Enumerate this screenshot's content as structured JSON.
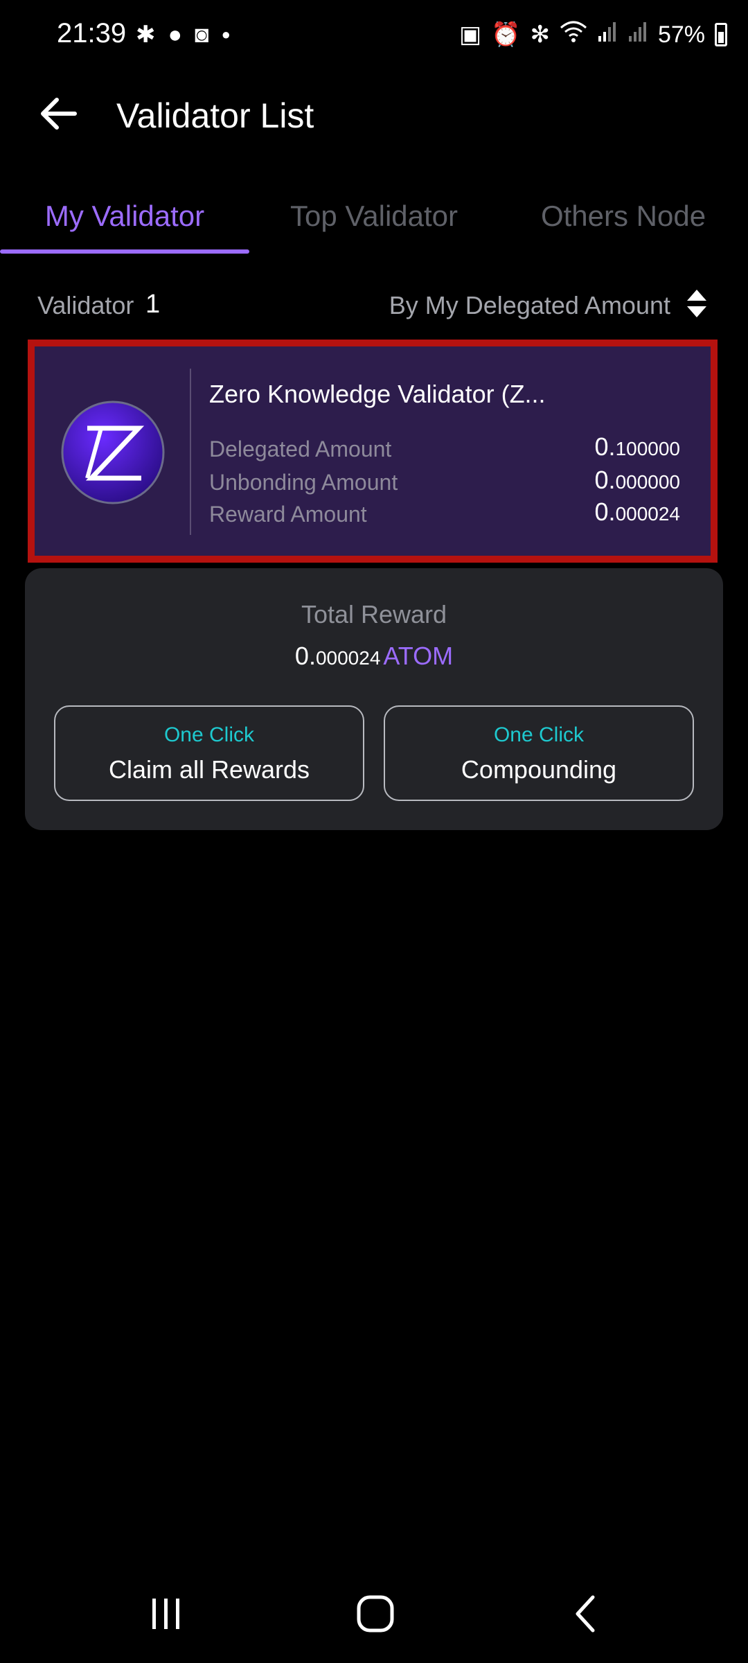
{
  "status_bar": {
    "time": "21:39",
    "battery": "57%",
    "left_icons": [
      "slack-icon",
      "chat-icon",
      "camera-app-icon",
      "dot-icon"
    ],
    "right_icons": [
      "battery-saver-icon",
      "alarm-icon",
      "bluetooth-icon",
      "wifi-icon",
      "signal-icon",
      "signal-icon-2"
    ]
  },
  "app_bar": {
    "title": "Validator List"
  },
  "tabs": [
    {
      "label": "My Validator",
      "active": true
    },
    {
      "label": "Top Validator",
      "active": false
    },
    {
      "label": "Others Node",
      "active": false
    }
  ],
  "summary": {
    "count_label": "Validator",
    "count": "1",
    "sort_label": "By My Delegated Amount"
  },
  "validator": {
    "logo_letter": "Z",
    "name": "Zero Knowledge Validator (Z...",
    "delegated_label": "Delegated Amount",
    "delegated_int": "0.",
    "delegated_dec": "100000",
    "unbonding_label": "Unbonding Amount",
    "unbonding_int": "0.",
    "unbonding_dec": "000000",
    "reward_label": "Reward Amount",
    "reward_int": "0.",
    "reward_dec": "000024"
  },
  "reward_panel": {
    "label": "Total Reward",
    "value_int": "0.",
    "value_dec": "000024",
    "denom": "ATOM",
    "claim_top": "One Click",
    "claim_main": "Claim all Rewards",
    "compound_top": "One Click",
    "compound_main": "Compounding"
  },
  "colors": {
    "accent": "#9c6cff",
    "teal": "#1ec9cf",
    "highlight_border": "#b5120f",
    "card_bg": "#2d1d4c",
    "panel_bg": "#232428"
  }
}
